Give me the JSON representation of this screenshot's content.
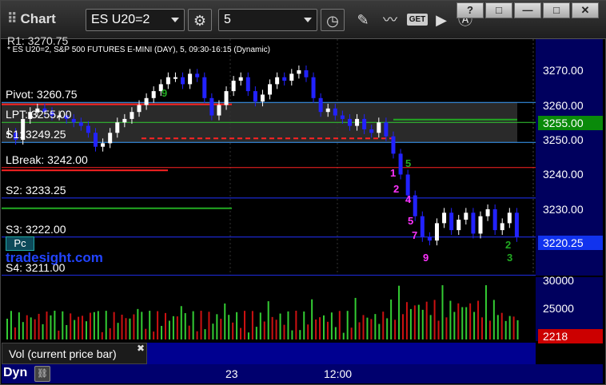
{
  "toolbar": {
    "title": "Chart",
    "symbol": "ES U20=2",
    "interval": "5",
    "get_label": "GET"
  },
  "window_buttons": [
    "?",
    "□",
    "—",
    "□",
    "✕"
  ],
  "chart": {
    "caption": "* ES U20=2, S&P 500 FUTURES E-MINI (DAY), 5, 09:30-16:15 (Dynamic)",
    "brand": "tradesight.com",
    "pc_badge": "Pc",
    "r1_partial": "R1: 3270.75",
    "levels": [
      {
        "label": "Pivot: 3260.75",
        "value": 3260.75,
        "color": "#3aa0ff"
      },
      {
        "label": "LPT: 3255.00",
        "value": 3255.0,
        "color": "#33cc33"
      },
      {
        "label": "S1: 3249.25",
        "value": 3249.25,
        "color": "#3aa0ff"
      },
      {
        "label": "LBreak: 3242.00",
        "value": 3242.0,
        "color": "#ff2222"
      },
      {
        "label": "S2: 3233.25",
        "value": 3233.25,
        "color": "#2233ff"
      },
      {
        "label": "S3: 3222.00",
        "value": 3222.0,
        "color": "#2233ff"
      },
      {
        "label": "S4: 3211.00",
        "value": 3211.0,
        "color": "#2233ff"
      }
    ],
    "price_ticks": [
      "3270.00",
      "3260.00",
      "3250.00",
      "3240.00",
      "3230.00"
    ],
    "tag_green": "3255.00",
    "tag_blue": "3220.25",
    "vol_ticks": [
      "30000",
      "25000"
    ],
    "vol_tag": "2218",
    "vol_label": "Vol (current price bar)",
    "time_ticks": [
      "23",
      "12:00"
    ],
    "dyn": "Dyn",
    "colors": {
      "up": "#ffffff",
      "down": "#2222ff",
      "vol_up": "#33cc33",
      "vol_down": "#cc1111",
      "axis_bg": "#00005e",
      "tag_green_bg": "#0a8a0a",
      "tag_blue_bg": "#1133ee",
      "vol_tag_bg": "#cc0000"
    }
  }
}
